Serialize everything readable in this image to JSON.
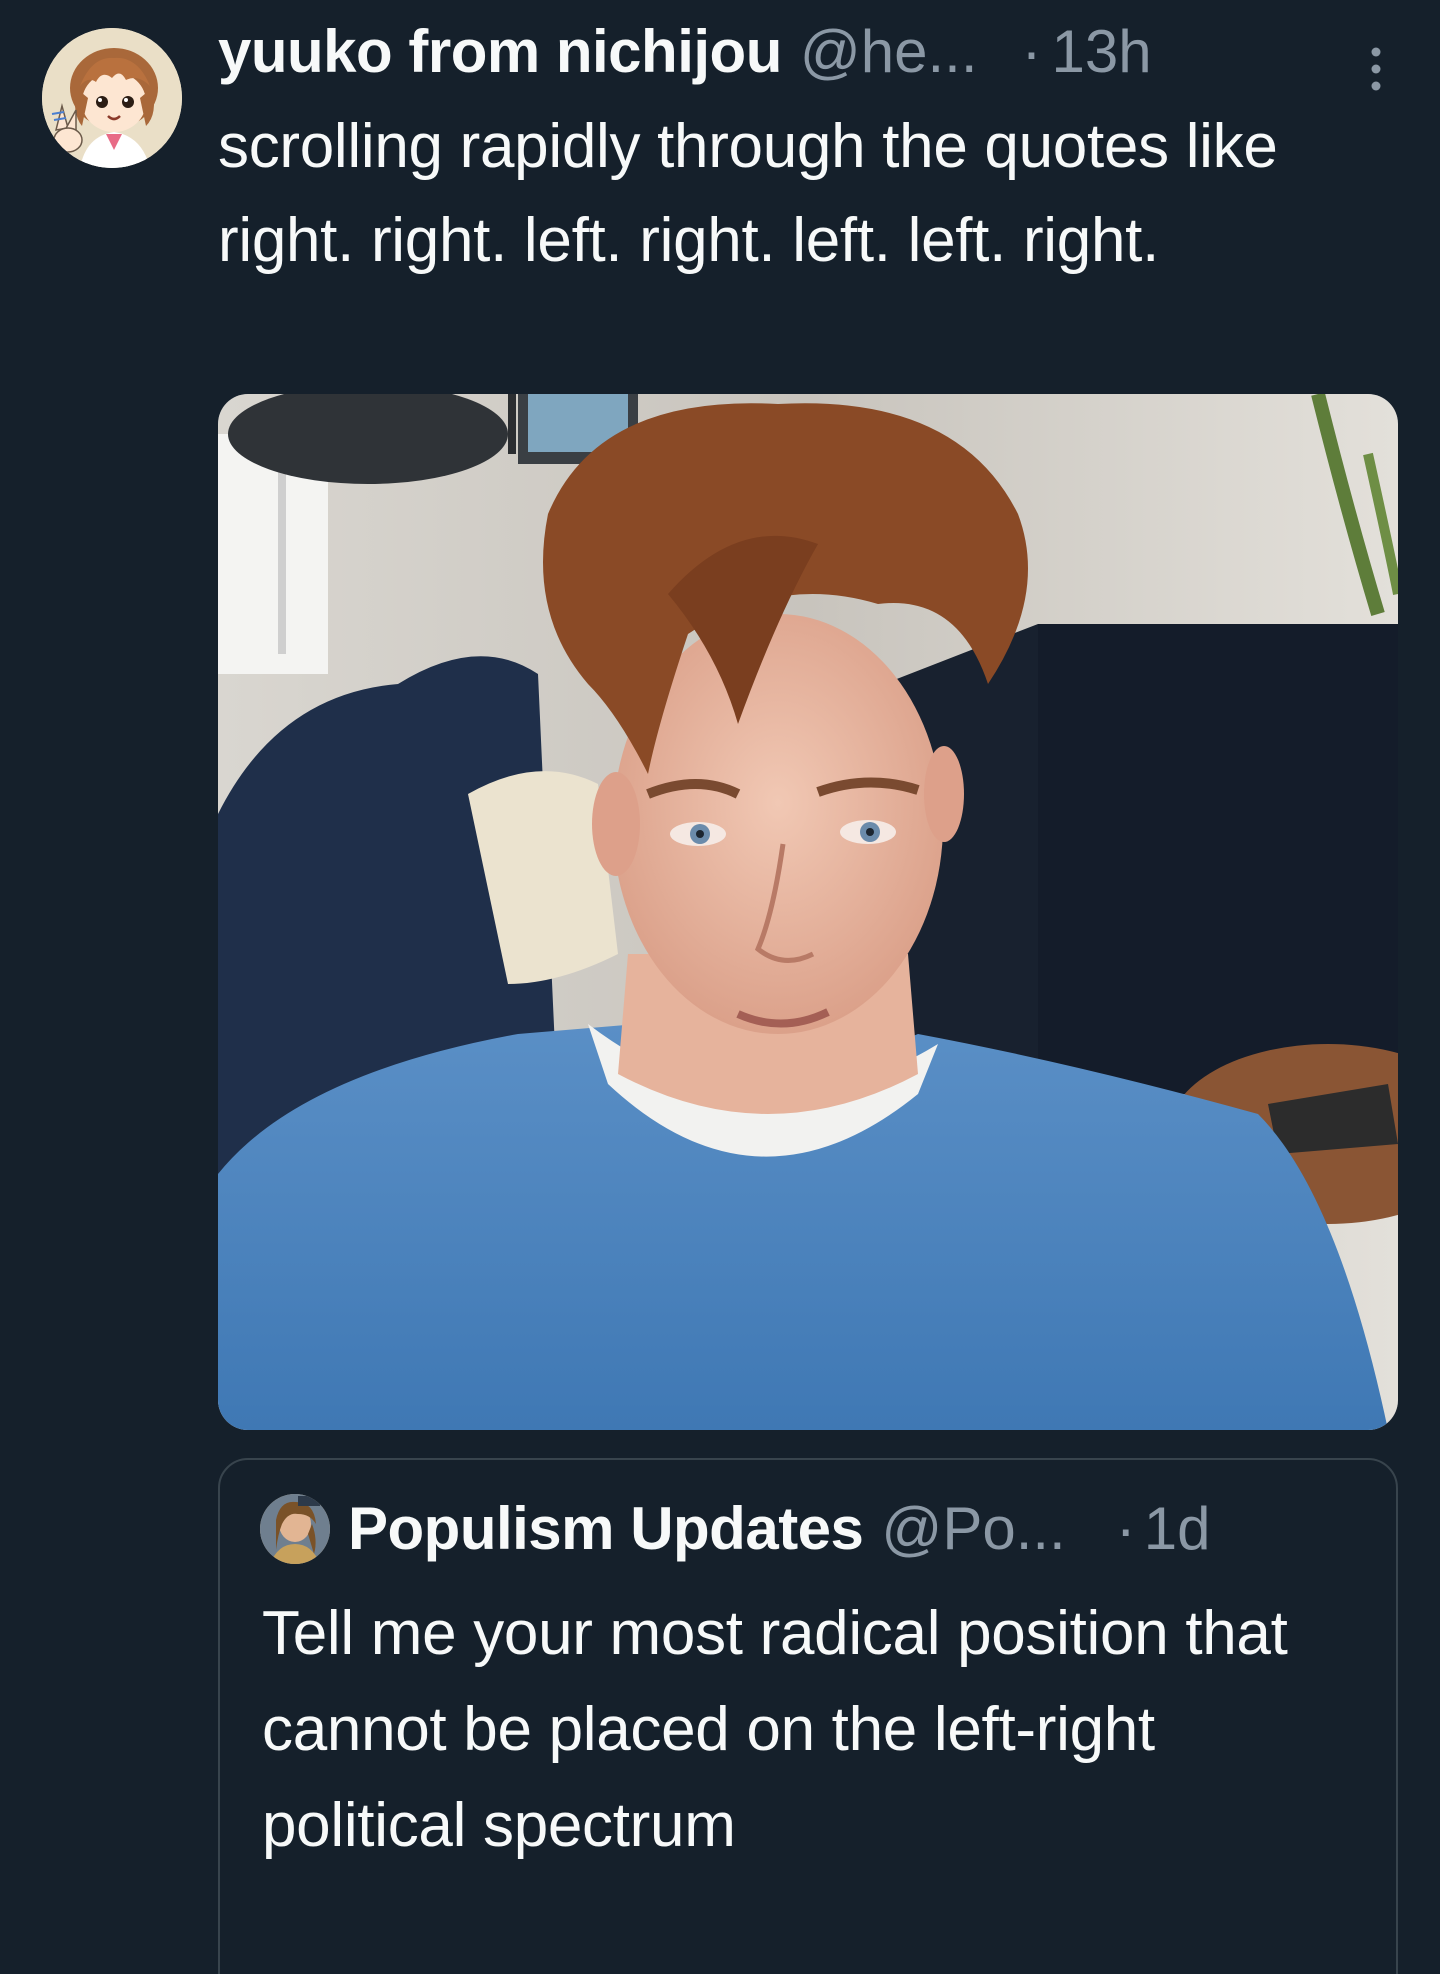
{
  "tweet": {
    "display_name": "yuuko from nichijou",
    "handle": "@he...",
    "separator": "·",
    "time": "13h",
    "more_icon": "vertical-ellipsis-icon",
    "text": "scrolling rapidly through the quotes like right. right. left. right. left. left. right.",
    "avatar_icon": "anime-girl-avatar",
    "media": {
      "kind": "photo",
      "subject": "photo"
    }
  },
  "quote": {
    "display_name": "Populism Updates",
    "handle": "@Po...",
    "separator": "·",
    "time": "1d",
    "avatar_icon": "user-avatar",
    "text": "Tell me your most radical position that cannot be placed on the left-right political spectrum"
  },
  "colors": {
    "background": "#15202b",
    "text_primary": "#f7f9f9",
    "text_secondary": "#8b98a5",
    "border": "#38444d"
  }
}
